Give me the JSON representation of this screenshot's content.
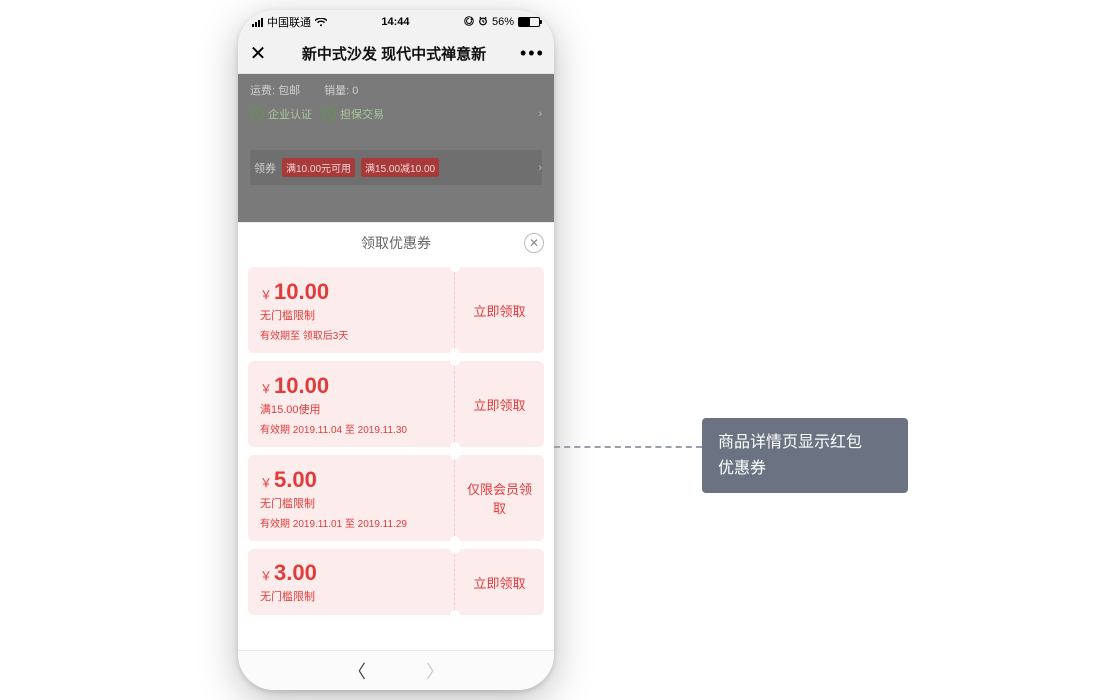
{
  "status": {
    "carrier": "中国联通",
    "time": "14:44",
    "battery_pct": "56%"
  },
  "nav": {
    "title": "新中式沙发 现代中式禅意新"
  },
  "scrim": {
    "shipping_label": "运费:",
    "shipping_value": "包邮",
    "sales_label": "销量:",
    "sales_value": "0",
    "cert_company": "企业认证",
    "cert_escrow": "担保交易",
    "coupon_label": "领券",
    "tag1": "满10.00元可用",
    "tag2": "满15.00减10.00"
  },
  "sheet": {
    "title": "领取优惠券"
  },
  "coupons": [
    {
      "currency": "￥",
      "amount": "10.00",
      "condition": "无门槛限制",
      "validity": "有效期至 领取后3天",
      "action": "立即领取"
    },
    {
      "currency": "￥",
      "amount": "10.00",
      "condition": "满15.00使用",
      "validity": "有效期 2019.11.04 至 2019.11.30",
      "action": "立即领取"
    },
    {
      "currency": "￥",
      "amount": "5.00",
      "condition": "无门槛限制",
      "validity": "有效期 2019.11.01 至 2019.11.29",
      "action": "仅限会员领取"
    },
    {
      "currency": "￥",
      "amount": "3.00",
      "condition": "无门槛限制",
      "validity": "",
      "action": "立即领取"
    }
  ],
  "callout": {
    "line1": "商品详情页显示红包",
    "line2": "优惠券"
  }
}
